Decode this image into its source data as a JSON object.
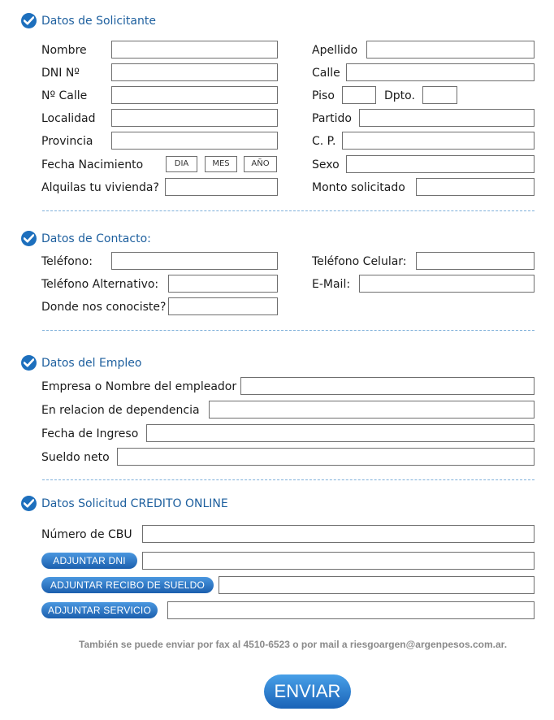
{
  "sections": {
    "solicitante": "Datos de Solicitante",
    "contacto": "Datos de Contacto:",
    "empleo": "Datos del Empleo",
    "credito": "Datos Solicitud CREDITO ONLINE"
  },
  "solicitante": {
    "nombre": "Nombre",
    "apellido": "Apellido",
    "dni": "DNI Nº",
    "calle": "Calle",
    "nro_calle": "Nº Calle",
    "piso": "Piso",
    "dpto": "Dpto.",
    "localidad": "Localidad",
    "partido": "Partido",
    "provincia": "Provincia",
    "cp": "C. P.",
    "fecha_nacimiento": "Fecha Nacimiento",
    "dia": "DIA",
    "mes": "MES",
    "anio": "AÑO",
    "sexo": "Sexo",
    "alquilas": "Alquilas tu vivienda?",
    "monto": "Monto solicitado"
  },
  "contacto": {
    "telefono": "Teléfono:",
    "celular": "Teléfono Celular:",
    "alternativo": "Teléfono Alternativo:",
    "email": "E-Mail:",
    "conociste": "Donde nos conociste?"
  },
  "empleo": {
    "empresa": "Empresa o Nombre del empleador",
    "relacion": "En relacion de dependencia",
    "fecha_ingreso": "Fecha de Ingreso",
    "sueldo": "Sueldo neto"
  },
  "credito": {
    "cbu": "Número de CBU",
    "adjuntar_dni": "ADJUNTAR DNI",
    "adjuntar_recibo": "ADJUNTAR RECIBO DE SUELDO",
    "adjuntar_servicio": "ADJUNTAR SERVICIO"
  },
  "footer": {
    "note": "También se puede enviar por fax al 4510-6523 o por mail a riesgoargen@argenpesos.com.ar.",
    "submit": "ENVIAR"
  },
  "colors": {
    "accent": "#1d6fbd",
    "section_title": "#1d5f9e",
    "divider": "#7fb0da",
    "note": "#8a8a8a"
  }
}
